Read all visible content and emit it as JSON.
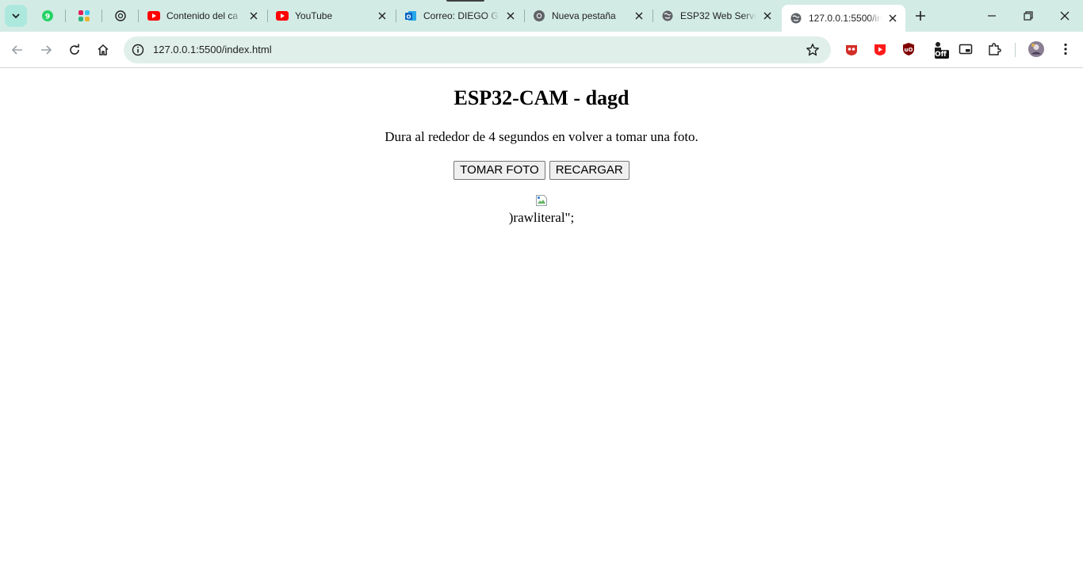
{
  "browser": {
    "tabs": [
      {
        "title": "Contenido del ca",
        "favicon": "youtube-icon"
      },
      {
        "title": "YouTube",
        "favicon": "youtube-icon"
      },
      {
        "title": "Correo: DIEGO G",
        "favicon": "outlook-icon"
      },
      {
        "title": "Nueva pestaña",
        "favicon": "chrome-icon"
      },
      {
        "title": "ESP32 Web Serve",
        "favicon": "globe-icon"
      },
      {
        "title": "127.0.0.1:5500/in",
        "favicon": "globe-icon",
        "active": true
      }
    ],
    "pinned_tabs": [
      "whatsapp-icon",
      "slack-icon",
      "openai-icon"
    ],
    "address_bar": {
      "url": "127.0.0.1:5500/index.html"
    },
    "extensions": [
      "lastpass-icon",
      "video-speed-icon",
      "ublock-icon",
      "dark-reader-off-icon",
      "picture-in-picture-icon",
      "extensions-puzzle-icon"
    ],
    "extension_badge": "Off"
  },
  "page": {
    "heading": "ESP32-CAM - dagd",
    "description": "Dura al rededor de 4 segundos en volver a tomar una foto.",
    "buttons": {
      "take_photo": "TOMAR FOTO",
      "reload": "RECARGAR"
    },
    "trailing_text": ")rawliteral\";"
  },
  "colors": {
    "tabstrip": "#d3ebe5",
    "omnibox": "#e0efea",
    "youtube_red": "#ff0000",
    "outlook_blue": "#0a64c2"
  }
}
